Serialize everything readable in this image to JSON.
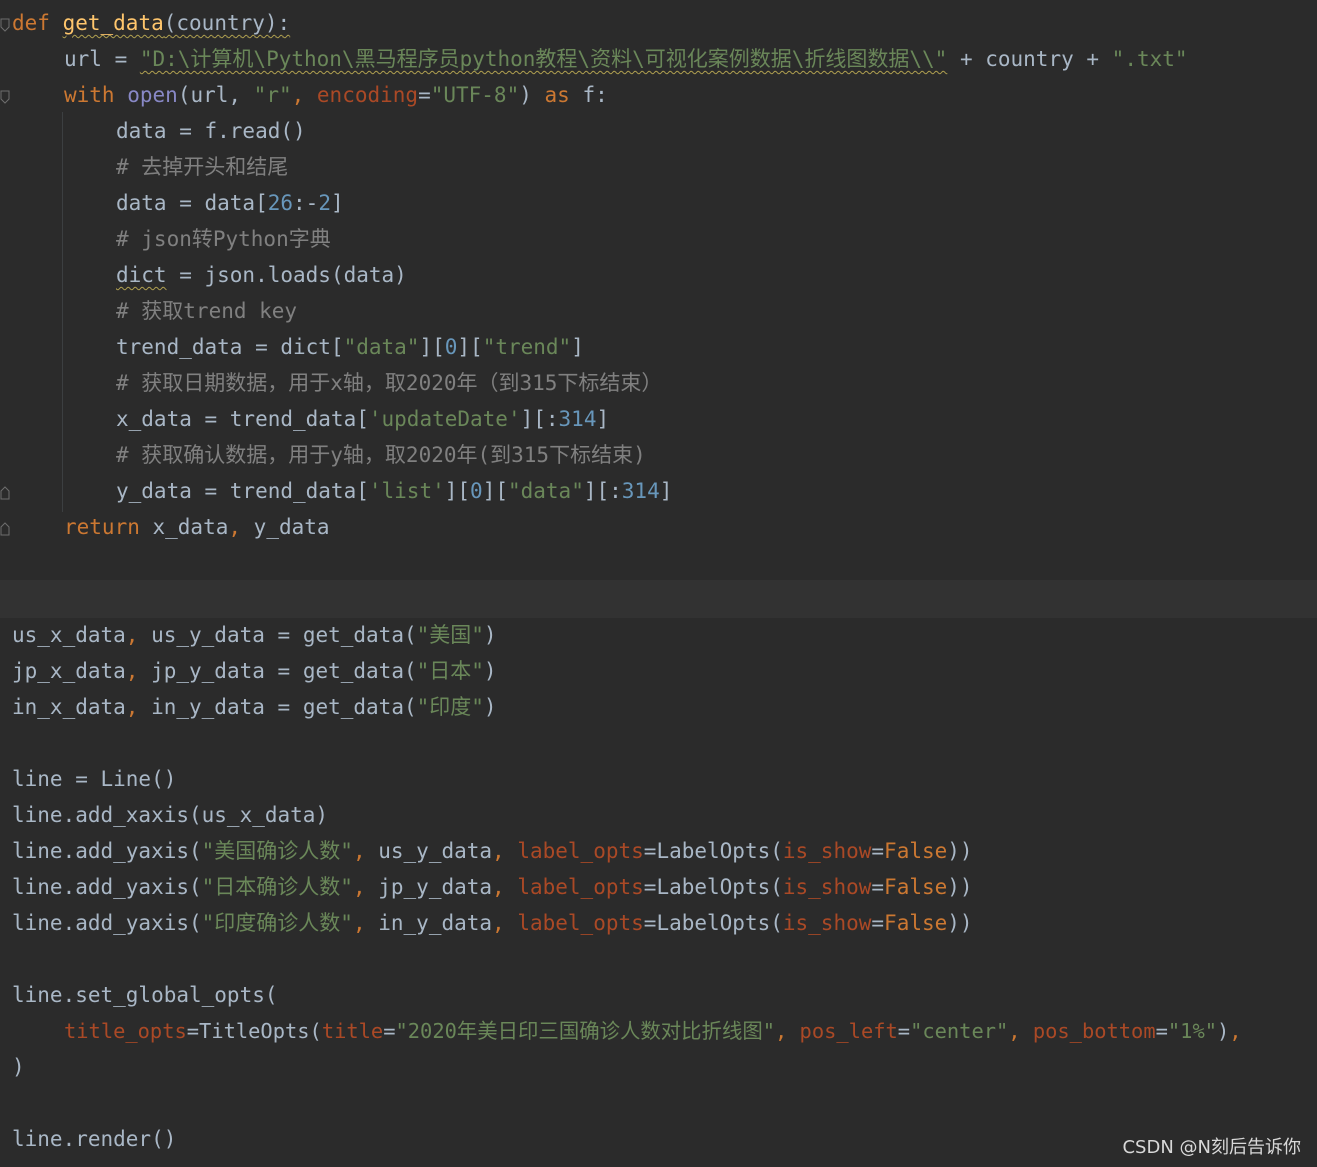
{
  "code": {
    "l1_def": "def",
    "l1_name": "get_data",
    "l1_rest": "(country):",
    "l2_a": "url = ",
    "l2_str": "\"D:\\计算机\\Python\\黑马程序员python教程\\资料\\可视化案例数据\\折线图数据\\\\\"",
    "l2_b": " + country + ",
    "l2_str2": "\".txt\"",
    "l3_with": "with",
    "l3_open": "open",
    "l3_a": "(url, ",
    "l3_r": "\"r\"",
    "l3_c": ", ",
    "l3_enc": "encoding",
    "l3_eq": "=",
    "l3_utf": "\"UTF-8\"",
    "l3_close": ") ",
    "l3_as": "as",
    "l3_f": " f:",
    "l4": "data = f.read()",
    "l5": "# 去掉开头和结尾",
    "l6_a": "data = data[",
    "l6_n1": "26",
    "l6_b": ":-",
    "l6_n2": "2",
    "l6_c": "]",
    "l7": "# json转Python字典",
    "l8_dict": "dict",
    "l8_rest": " = json.loads(data)",
    "l9": "# 获取trend key",
    "l10_a": "trend_data = dict[",
    "l10_s1": "\"data\"",
    "l10_b": "][",
    "l10_n": "0",
    "l10_c": "][",
    "l10_s2": "\"trend\"",
    "l10_d": "]",
    "l11": "# 获取日期数据，用于x轴，取2020年（到315下标结束）",
    "l12_a": "x_data = trend_data[",
    "l12_s": "'updateDate'",
    "l12_b": "][:",
    "l12_n": "314",
    "l12_c": "]",
    "l13": "# 获取确认数据，用于y轴，取2020年(到315下标结束)",
    "l14_a": "y_data = trend_data[",
    "l14_s1": "'list'",
    "l14_b": "][",
    "l14_n0": "0",
    "l14_c": "][",
    "l14_s2": "\"data\"",
    "l14_d": "][:",
    "l14_n": "314",
    "l14_e": "]",
    "l15_ret": "return",
    "l15_a": " x_data",
    "l15_comma": ",",
    "l15_b": " y_data",
    "l16_a": "us_x_data",
    "l16_comma": ",",
    "l16_b": " us_y_data = get_data(",
    "l16_s": "\"美国\"",
    "l16_c": ")",
    "l17_a": "jp_x_data",
    "l17_comma": ",",
    "l17_b": " jp_y_data = get_data(",
    "l17_s": "\"日本\"",
    "l17_c": ")",
    "l18_a": "in_x_data",
    "l18_comma": ",",
    "l18_b": " in_y_data = get_data(",
    "l18_s": "\"印度\"",
    "l18_c": ")",
    "l19": "line = Line()",
    "l20": "line.add_xaxis(us_x_data)",
    "l21_a": "line.add_yaxis(",
    "l21_s": "\"美国确诊人数\"",
    "l21_c1": ",",
    "l21_b": " us_y_data",
    "l21_c2": ",",
    "l22_s": "\"日本确诊人数\"",
    "l22_b": " jp_y_data",
    "l23_s": "\"印度确诊人数\"",
    "l23_b": " in_y_data",
    "yaxis_label_opts": " label_opts",
    "yaxis_eq": "=",
    "yaxis_lo": "LabelOpts(",
    "yaxis_is_show": "is_show",
    "yaxis_eq2": "=",
    "yaxis_false": "False",
    "yaxis_end": "))",
    "l24": "line.set_global_opts(",
    "l25_param": "title_opts",
    "l25_eq": "=",
    "l25_to": "TitleOpts(",
    "l25_title": "title",
    "l25_eq2": "=",
    "l25_s": "\"2020年美日印三国确诊人数对比折线图\"",
    "l25_c1": ",",
    "l25_pl": " pos_left",
    "l25_eq3": "=",
    "l25_center": "\"center\"",
    "l25_c2": ",",
    "l25_pb": " pos_bottom",
    "l25_eq4": "=",
    "l25_pct": "\"1%\"",
    "l25_end": ")",
    "l25_c3": ",",
    "l26": ")",
    "l27": "line.render()"
  },
  "watermark": "CSDN @N刻后告诉你"
}
